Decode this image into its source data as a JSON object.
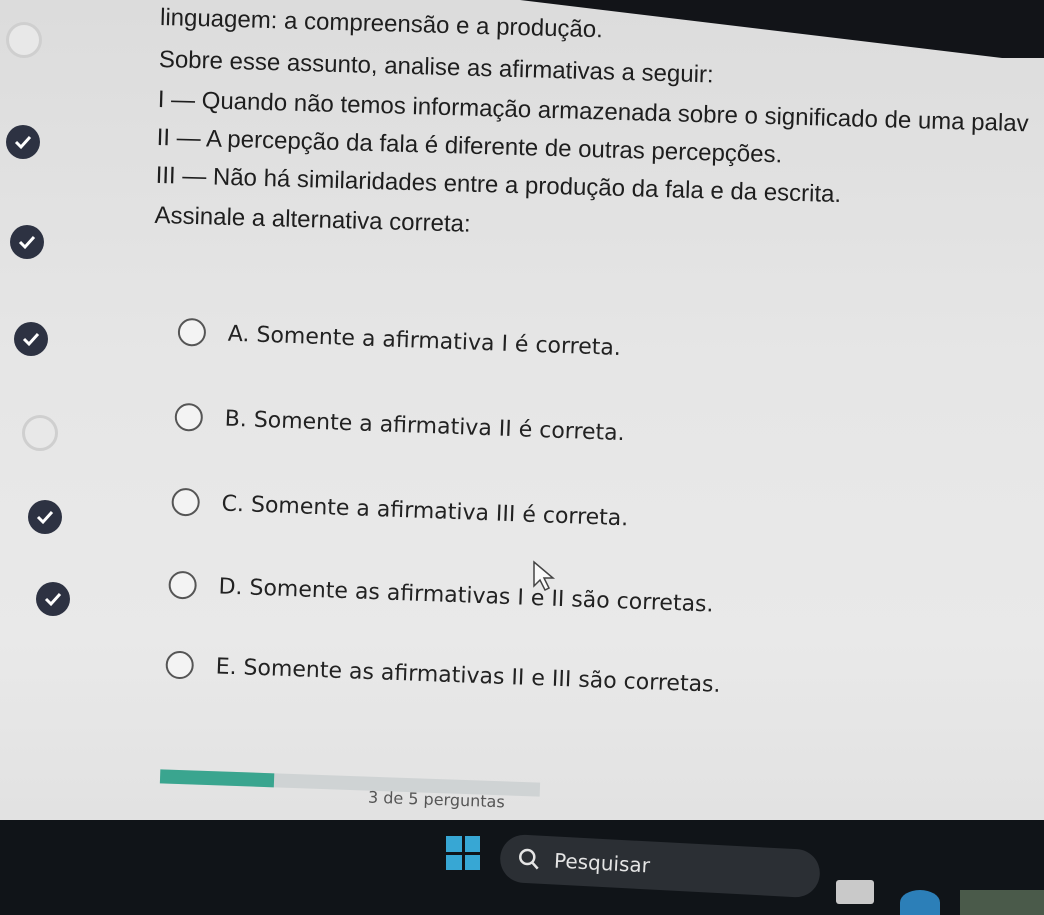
{
  "question": {
    "line_intro": "linguagem: a compreensão e a produção.",
    "line_prompt": "Sobre esse assunto, analise as afirmativas a seguir:",
    "statement_1": "I — Quando não temos informação armazenada sobre o significado de uma palav",
    "statement_2": "II — A percepção da fala é diferente de outras percepções.",
    "statement_3": "III — Não há similaridades entre a produção da fala e da escrita.",
    "instruction": "Assinale a alternativa correta:"
  },
  "options": [
    {
      "label": "A. Somente a afirmativa I é correta.",
      "selected": false
    },
    {
      "label": "B. Somente a afirmativa II é correta.",
      "selected": false
    },
    {
      "label": "C. Somente a afirmativa III é correta.",
      "selected": false
    },
    {
      "label": "D. Somente as afirmativas I e II são corretas.",
      "selected": false
    },
    {
      "label": "E. Somente as afirmativas II e III são corretas.",
      "selected": false
    }
  ],
  "sidebar": {
    "markers": [
      "open",
      "done",
      "done",
      "done",
      "open",
      "done",
      "done"
    ]
  },
  "progress": {
    "text": "3 de 5 perguntas",
    "fraction": 0.3
  },
  "taskbar": {
    "search_placeholder": "Pesquisar"
  },
  "colors": {
    "accent": "#2d3242",
    "progress": "#3aa58f",
    "windows": "#37a7d4"
  },
  "icons": {
    "windows": "windows-logo-icon",
    "search": "search-icon",
    "check": "check-icon",
    "cursor": "mouse-pointer-icon"
  }
}
